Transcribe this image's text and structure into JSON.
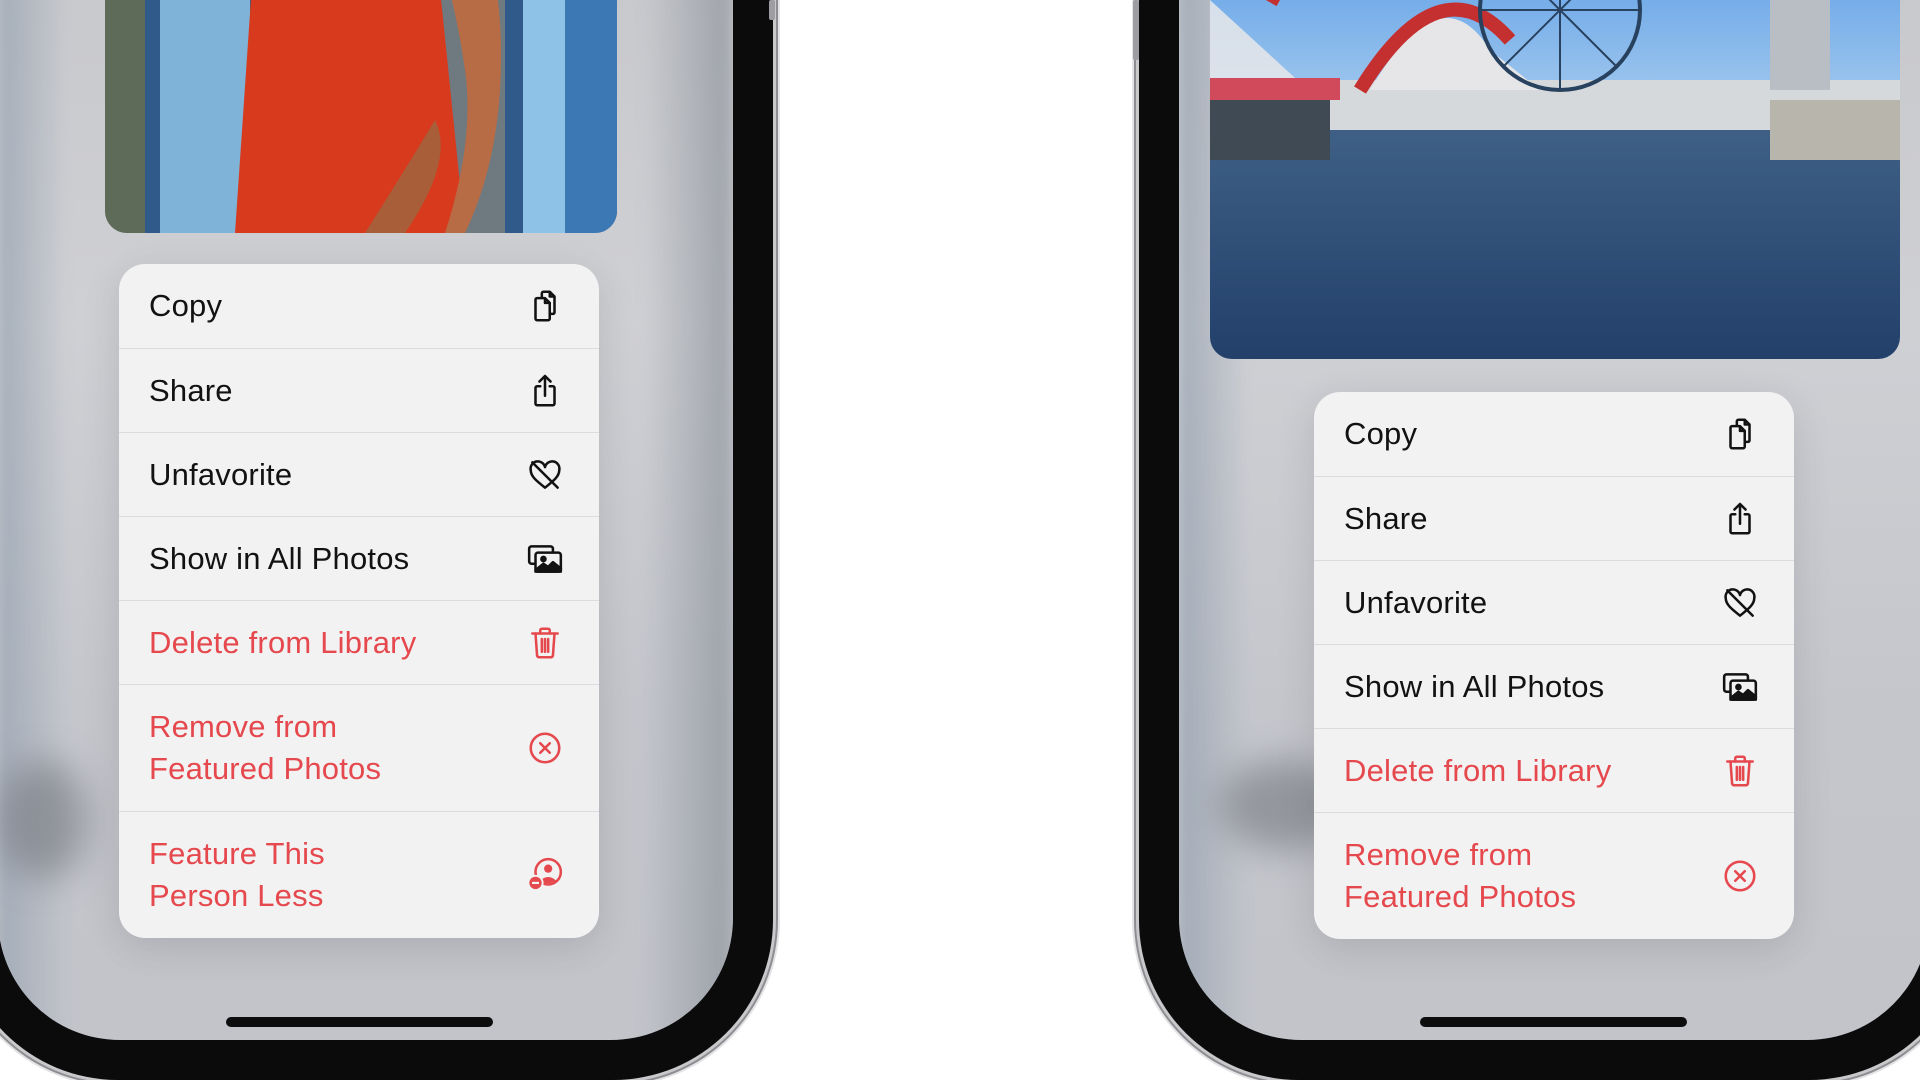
{
  "colors": {
    "destructive": "#e5484d",
    "text": "#121212",
    "menu_background": "#f2f2f3"
  },
  "left_phone": {
    "photo_subject": "person in red dress",
    "menu": [
      {
        "label": "Copy",
        "icon": "copy-icon",
        "destructive": false
      },
      {
        "label": "Share",
        "icon": "share-icon",
        "destructive": false
      },
      {
        "label": "Unfavorite",
        "icon": "heart-slash-icon",
        "destructive": false
      },
      {
        "label": "Show in All Photos",
        "icon": "photos-icon",
        "destructive": false
      },
      {
        "label": "Delete from Library",
        "icon": "trash-icon",
        "destructive": true
      },
      {
        "label": "Remove from\nFeatured Photos",
        "icon": "x-circle-icon",
        "destructive": true
      },
      {
        "label": "Feature This\nPerson Less",
        "icon": "person-minus-icon",
        "destructive": true
      }
    ]
  },
  "right_phone": {
    "photo_subject": "theme park lagoon with ferris wheel",
    "menu": [
      {
        "label": "Copy",
        "icon": "copy-icon",
        "destructive": false
      },
      {
        "label": "Share",
        "icon": "share-icon",
        "destructive": false
      },
      {
        "label": "Unfavorite",
        "icon": "heart-slash-icon",
        "destructive": false
      },
      {
        "label": "Show in All Photos",
        "icon": "photos-icon",
        "destructive": false
      },
      {
        "label": "Delete from Library",
        "icon": "trash-icon",
        "destructive": true
      },
      {
        "label": "Remove from\nFeatured Photos",
        "icon": "x-circle-icon",
        "destructive": true
      }
    ]
  }
}
